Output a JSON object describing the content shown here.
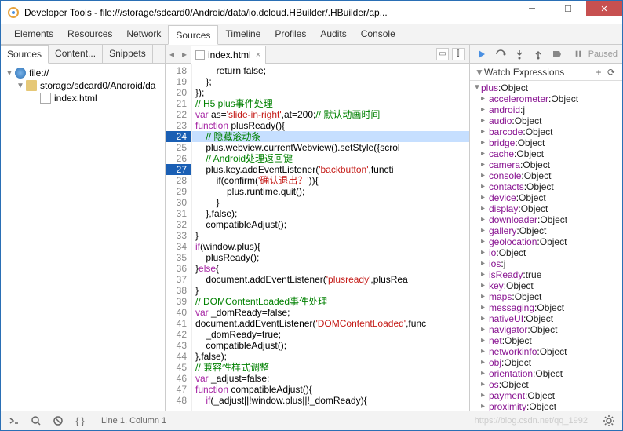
{
  "window": {
    "title": "Developer Tools - file:///storage/sdcard0/Android/data/io.dcloud.HBuilder/.HBuilder/ap..."
  },
  "tabs": {
    "items": [
      "Elements",
      "Resources",
      "Network",
      "Sources",
      "Timeline",
      "Profiles",
      "Audits",
      "Console"
    ],
    "active": 3
  },
  "subtabs": {
    "items": [
      "Sources",
      "Content...",
      "Snippets"
    ],
    "active": 0
  },
  "tree": {
    "root": "file://",
    "folder": "storage/sdcard0/Android/da",
    "file": "index.html"
  },
  "editor": {
    "tab": "index.html",
    "startLine": 18,
    "highlight": [
      24,
      27
    ],
    "lines": [
      {
        "t": "        return false;"
      },
      {
        "t": "    };"
      },
      {
        "t": "});"
      },
      {
        "cm": "// H5 plus事件处理"
      },
      {
        "raw": "<span class='kw'>var</span> as=<span class='str'>'slide-in-right'</span>,at=200;<span class='cm'>// 默认动画时间</span>"
      },
      {
        "raw": "<span class='kw'>function</span> plusReady(){"
      },
      {
        "raw": "    <span class='cm'>// 隐藏滚动条</span>"
      },
      {
        "raw": "    plus.webview.currentWebview().setStyle({scrol"
      },
      {
        "raw": "    <span class='cm'>// Android处理返回键</span>"
      },
      {
        "raw": "    plus.key.addEventListener(<span class='str'>'backbutton'</span>,functi"
      },
      {
        "raw": "        if(confirm(<span class='str'>'确认退出？'</span>)){"
      },
      {
        "t": "            plus.runtime.quit();"
      },
      {
        "t": "        }"
      },
      {
        "t": "    },false);"
      },
      {
        "t": "    compatibleAdjust();"
      },
      {
        "t": "}"
      },
      {
        "raw": "<span class='kw'>if</span>(window.plus){"
      },
      {
        "t": "    plusReady();"
      },
      {
        "raw": "}<span class='kw'>else</span>{"
      },
      {
        "raw": "    document.addEventListener(<span class='str'>'plusready'</span>,plusRea"
      },
      {
        "t": "}"
      },
      {
        "cm": "// DOMContentLoaded事件处理"
      },
      {
        "raw": "<span class='kw'>var</span> _domReady=false;"
      },
      {
        "raw": "document.addEventListener(<span class='str'>'DOMContentLoaded'</span>,func"
      },
      {
        "t": "    _domReady=true;"
      },
      {
        "t": "    compatibleAdjust();"
      },
      {
        "t": "},false);"
      },
      {
        "cm": "// 兼容性样式调整"
      },
      {
        "raw": "<span class='kw'>var</span> _adjust=false;"
      },
      {
        "raw": "<span class='kw'>function</span> compatibleAdjust(){"
      },
      {
        "raw": "    <span class='kw'>if</span>(_adjust||!window.plus||!_domReady){"
      }
    ]
  },
  "paused": "Paused",
  "watchHeader": "Watch Expressions",
  "watch": {
    "root": {
      "k": "plus",
      "v": "Object"
    },
    "items": [
      {
        "k": "accelerometer",
        "v": "Object"
      },
      {
        "k": "android",
        "v": "j"
      },
      {
        "k": "audio",
        "v": "Object"
      },
      {
        "k": "barcode",
        "v": "Object"
      },
      {
        "k": "bridge",
        "v": "Object"
      },
      {
        "k": "cache",
        "v": "Object"
      },
      {
        "k": "camera",
        "v": "Object"
      },
      {
        "k": "console",
        "v": "Object"
      },
      {
        "k": "contacts",
        "v": "Object"
      },
      {
        "k": "device",
        "v": "Object"
      },
      {
        "k": "display",
        "v": "Object"
      },
      {
        "k": "downloader",
        "v": "Object"
      },
      {
        "k": "gallery",
        "v": "Object"
      },
      {
        "k": "geolocation",
        "v": "Object"
      },
      {
        "k": "io",
        "v": "Object"
      },
      {
        "k": "ios",
        "v": "j"
      },
      {
        "k": "isReady",
        "v": "true"
      },
      {
        "k": "key",
        "v": "Object"
      },
      {
        "k": "maps",
        "v": "Object"
      },
      {
        "k": "messaging",
        "v": "Object"
      },
      {
        "k": "nativeUI",
        "v": "Object"
      },
      {
        "k": "navigator",
        "v": "Object"
      },
      {
        "k": "net",
        "v": "Object"
      },
      {
        "k": "networkinfo",
        "v": "Object"
      },
      {
        "k": "obj",
        "v": "Object"
      },
      {
        "k": "orientation",
        "v": "Object"
      },
      {
        "k": "os",
        "v": "Object"
      },
      {
        "k": "payment",
        "v": "Object"
      },
      {
        "k": "proximity",
        "v": "Object"
      }
    ]
  },
  "status": {
    "cursor": "Line 1, Column 1",
    "watermark": "https://blog.csdn.net/qq_1992"
  }
}
